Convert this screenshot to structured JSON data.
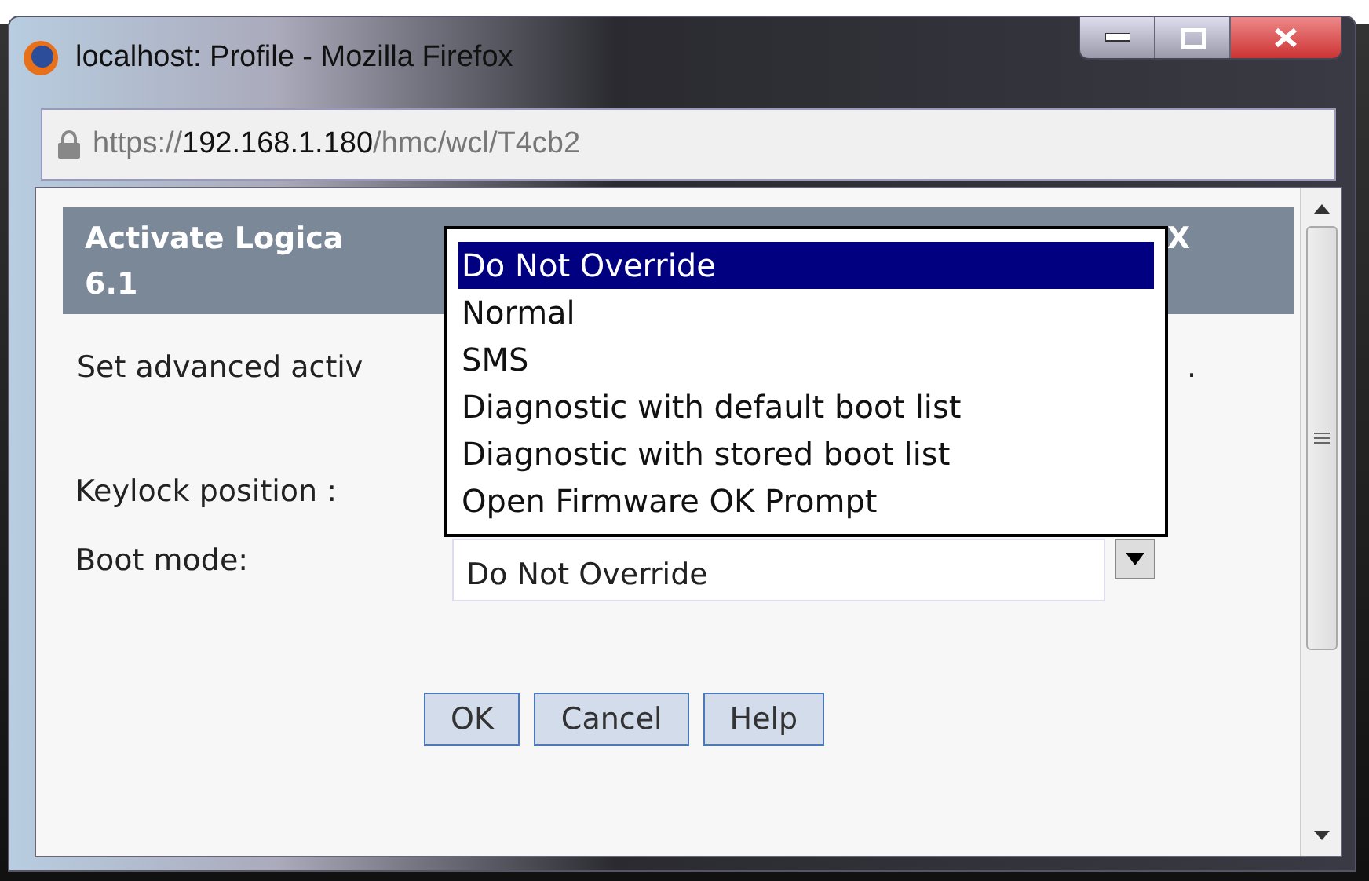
{
  "window": {
    "title": "localhost: Profile - Mozilla Firefox"
  },
  "address_bar": {
    "scheme": "https://",
    "host": "192.168.1.180",
    "path": "/hmc/wcl/T4cb2"
  },
  "header": {
    "visible_left": "Activate Logica",
    "visible_right": "X",
    "line_2": "6.1"
  },
  "description": {
    "visible_left": "Set advanced activ",
    "visible_right": "."
  },
  "fields": [
    {
      "label": "Keylock position :"
    },
    {
      "label": "Boot mode:",
      "value": "Do Not Override"
    }
  ],
  "dropdown": {
    "options": [
      {
        "label": "Do Not Override",
        "selected": true
      },
      {
        "label": "Normal",
        "selected": false
      },
      {
        "label": "SMS",
        "selected": false
      },
      {
        "label": "Diagnostic with default boot list",
        "selected": false
      },
      {
        "label": "Diagnostic with stored boot list",
        "selected": false
      },
      {
        "label": "Open Firmware OK Prompt",
        "selected": false
      }
    ]
  },
  "buttons": [
    "OK",
    "Cancel",
    "Help"
  ]
}
